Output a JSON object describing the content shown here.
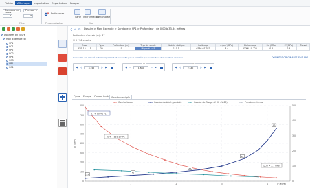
{
  "menu": {
    "items": [
      "Fichier",
      "Affichage",
      "Importation",
      "Exportation",
      "Rapport"
    ],
    "active_index": 1
  },
  "ribbon": {
    "filter_label": "Données en cours",
    "filter_value": "Pressio",
    "preferences_label": "Préférences",
    "btn_carte": "Carte",
    "btn_interpretation": "Interprétation",
    "btn_vue_familiale": "Vue familiale",
    "group_filtre": "Filtre",
    "group_personnalisation": "Personnalisation",
    "group_vue": "Vue"
  },
  "sidebar": {
    "root": "Données en cours",
    "project": "Mon_Exemple (8)",
    "items": [
      "SP1",
      "SC1",
      "SP2",
      "SC2",
      "SP3",
      "SC3",
      "SP1",
      "SC1"
    ],
    "selected_index": 6
  },
  "breadcrumb": {
    "text": "Dossier > Mon_Exemple > Sondage > SP1 > Profondeur : de 0.00 à 33.34 mètres"
  },
  "info": {
    "depth_label": "Profondeur d'essais (m) :",
    "depth_value": "37",
    "checkbox_label": "5 / 26 essai(s)"
  },
  "table": {
    "headers": [
      "Essai",
      "Type",
      "Profondeur (m)",
      "Type de sonde",
      "Module statique",
      "Calibrage",
      "a (cm²/MPa)",
      "Étalonnage",
      "Pel (MPa)",
      "Pf (MPa)",
      "Pressi"
    ],
    "row": [
      "SP1-15-1.15",
      "30",
      "15",
      "Mi-pavé x 63",
      "110.1",
      "CS66-07-762",
      "3.4",
      "ST66-10-720",
      "0.6",
      "2.4",
      ""
    ]
  },
  "recalc_note": "Ce courbe est calculé automatiquement et nécessite pas le contrôle par l'utilisateur des courbes, mesures",
  "link_raw_data": "DONNÉES ORIGINALES",
  "link_norm": "EN 1997",
  "controls": {
    "group1_label": "Pf",
    "group1_value": "4.225",
    "group2_label": "Pf",
    "group2_value": "1.880",
    "group3_label": "Pl",
    "group3_value": "2.540"
  },
  "tabs": {
    "items": [
      "Cycle",
      "Fluage",
      "Courbe brute",
      "Courbe corrigée"
    ],
    "active_index": 3
  },
  "chart_data": {
    "type": "line",
    "xlabel": "P (MPa)",
    "ylabel_left": "V (cm³)",
    "ylabel_right": "",
    "x_ticks": [
      "1",
      "2",
      "3",
      "4"
    ],
    "xlim": [
      0,
      4.5
    ],
    "y_left_ticks": [
      "0",
      "100",
      "200",
      "300",
      "400",
      "500",
      "600",
      "700",
      "800"
    ],
    "y_left_lim": [
      0,
      800
    ],
    "y_right_ticks": [
      "0",
      "100",
      "200",
      "300",
      "400",
      "500"
    ],
    "y_right_lim": [
      0,
      500
    ],
    "legend": [
      "Courbe brute",
      "Courbe double hyperbole",
      "Courbe de fluage (V 30 - V 60)",
      "Pression retenue"
    ],
    "annotations": {
      "v_label": "V1 + V0 + [V1]",
      "em_label": "EM = 110.1 MPa",
      "pl_label": "pLM = 2.7 MPa",
      "markers": [
        "P1",
        "P2",
        "P3",
        "P4",
        "P5"
      ]
    },
    "series": [
      {
        "name": "Courbe brute",
        "color": "#e15b54",
        "x": [
          0.0,
          0.35,
          0.7,
          1.05,
          1.4,
          1.75,
          2.1,
          2.45,
          2.8,
          3.15,
          3.5,
          3.85,
          4.2
        ],
        "y": [
          780,
          580,
          450,
          360,
          285,
          225,
          170,
          130,
          100,
          78,
          60,
          45,
          35
        ]
      },
      {
        "name": "Courbe double hyperbole",
        "color": "#2a3f8f",
        "x": [
          0.0,
          0.5,
          1.0,
          1.5,
          2.0,
          2.5,
          3.0,
          3.5,
          3.8,
          4.0,
          4.2
        ],
        "y": [
          30,
          45,
          60,
          75,
          95,
          120,
          160,
          240,
          330,
          430,
          560
        ]
      },
      {
        "name": "Courbe de fluage (V 30 - V 60)",
        "color": "#1f8f9b",
        "x": [
          0.2,
          0.8,
          1.4,
          2.0,
          2.6,
          3.2,
          3.8
        ],
        "y": [
          120,
          110,
          95,
          80,
          70,
          55,
          45
        ]
      }
    ]
  }
}
